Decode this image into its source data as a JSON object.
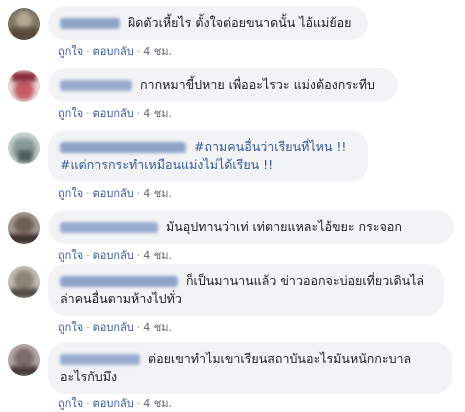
{
  "action_like": "ถูกใจ",
  "action_reply": "ตอบกลับ",
  "separator": "·",
  "comments": [
    {
      "text": "ผิดตัวเหี้ยไร ตั้งใจต่อยขนาดนั้น ไอ้แม่ย้อย",
      "time": "4 ชม.",
      "avatar_colors": [
        "#7f7566",
        "#b8a894",
        "#5a4a3c"
      ]
    },
    {
      "text": "กากหมาขี้ปหาย เพื่ออะไรวะ แม่งต้องกระทืบ",
      "time": "4 ชม.",
      "avatar_colors": [
        "#c45a66",
        "#f0e0d8",
        "#8a2a38"
      ]
    },
    {
      "hashtag1": "#ถามคนอื่นว่าเรียนที่ไหน !!",
      "hashtag2": "#แต่การกระทำเหมือนแม่งไม่ได้เรียน !!",
      "time": "4 ชม.",
      "avatar_colors": [
        "#8a9c9a",
        "#c8d4d0",
        "#4e5c5a"
      ]
    },
    {
      "text": "มันอุปทานว่าเท่ เท่ตายแหละไอ้ขยะ กระจอก",
      "time": "4 ชม.",
      "avatar_colors": [
        "#6e5e54",
        "#a89890",
        "#3e322c"
      ]
    },
    {
      "line1": "ก็เป็นมานานแล้ว ข่าวออกจะบ่อยเที่ยวเดินไล่",
      "line2": "ล่าคนอื่นตามห้างไปทั่ว",
      "time": "4 ชม.",
      "avatar_colors": [
        "#8c8478",
        "#c4bcb0",
        "#544c44"
      ]
    },
    {
      "line1": "ต่อยเขาทำไมเขาเรียนสถาบันอะไรมันหนักกะบาล",
      "line2": "อะไรกับมึง",
      "time": "4 ชม.",
      "avatar_colors": [
        "#7a6c6a",
        "#b8a8a4",
        "#463a38"
      ]
    }
  ]
}
